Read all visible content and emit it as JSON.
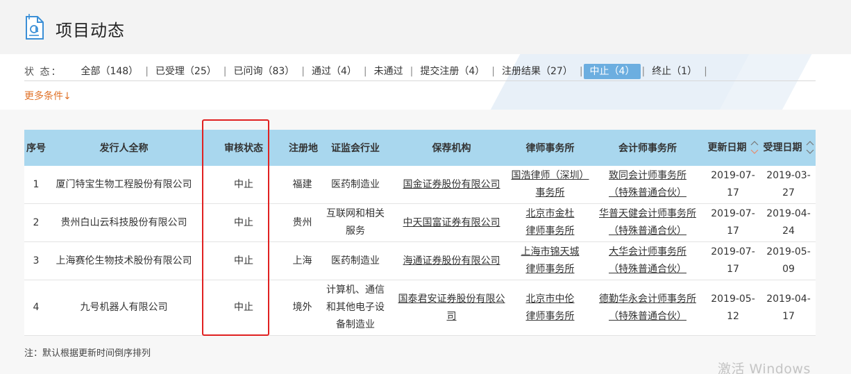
{
  "header": {
    "icon": "document-at-icon",
    "title": "项目动态"
  },
  "filters": {
    "status_label": "状  态：",
    "items": [
      {
        "label": "全部（148）",
        "active": false
      },
      {
        "label": "已受理（25）",
        "active": false
      },
      {
        "label": "已问询（83）",
        "active": false
      },
      {
        "label": "通过（4）",
        "active": false
      },
      {
        "label": "未通过",
        "active": false
      },
      {
        "label": "提交注册（4）",
        "active": false
      },
      {
        "label": "注册结果（27）",
        "active": false
      },
      {
        "label": "中止（4）",
        "active": true
      },
      {
        "label": "终止（1）",
        "active": false
      }
    ],
    "separator": "|",
    "more_conditions": "更多条件↓"
  },
  "table": {
    "headers": [
      "序号",
      "发行人全称",
      "审核状态",
      "注册地",
      "证监会行业",
      "保荐机构",
      "律师事务所",
      "会计师事务所",
      "更新日期",
      "受理日期"
    ],
    "rows": [
      {
        "no": "1",
        "issuer": "厦门特宝生物工程股份有限公司",
        "status": "中止",
        "region": "福建",
        "industry": [
          "医药制造业"
        ],
        "sponsor": "国金证券股份有限公司",
        "law": [
          "国浩律师（深圳）",
          "事务所"
        ],
        "accounting": [
          "致同会计师事务所",
          "（特殊普通合伙）"
        ],
        "updated": "2019-07-17",
        "accepted": "2019-03-27"
      },
      {
        "no": "2",
        "issuer": "贵州白山云科技股份有限公司",
        "status": "中止",
        "region": "贵州",
        "industry": [
          "互联网和相关",
          "服务"
        ],
        "sponsor": "中天国富证券有限公司",
        "law": [
          "北京市金杜",
          "律师事务所"
        ],
        "accounting": [
          "华普天健会计师事务所",
          "（特殊普通合伙）"
        ],
        "updated": "2019-07-17",
        "accepted": "2019-04-24"
      },
      {
        "no": "3",
        "issuer": "上海赛伦生物技术股份有限公司",
        "status": "中止",
        "region": "上海",
        "industry": [
          "医药制造业"
        ],
        "sponsor": "海通证券股份有限公司",
        "law": [
          "上海市锦天城",
          "律师事务所"
        ],
        "accounting": [
          "大华会计师事务所",
          "（特殊普通合伙）"
        ],
        "updated": "2019-07-17",
        "accepted": "2019-05-09"
      },
      {
        "no": "4",
        "issuer": "九号机器人有限公司",
        "status": "中止",
        "region": "境外",
        "industry": [
          "计算机、通信",
          "和其他电子设",
          "备制造业"
        ],
        "sponsor": "国泰君安证券股份有限公司",
        "law": [
          "北京市中伦",
          "律师事务所"
        ],
        "accounting": [
          "德勤华永会计师事务所",
          "（特殊普通合伙）"
        ],
        "updated": "2019-05-12",
        "accepted": "2019-04-17"
      }
    ]
  },
  "footnote": "注：默认根据更新时间倒序排列",
  "watermark": "激活 Windows",
  "colors": {
    "active_filter": "#6caee0",
    "table_header": "#a9d7ee",
    "more_link": "#e0732a",
    "highlight_box": "#e02020",
    "sort_active": "#e88a6a"
  }
}
